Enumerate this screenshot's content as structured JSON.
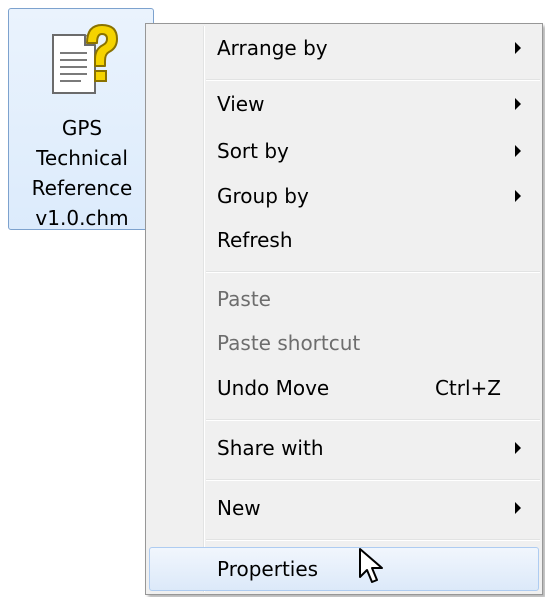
{
  "desktop": {
    "file": {
      "name_lines": [
        "GPS",
        "Technical",
        "Reference",
        "v1.0.chm"
      ],
      "icon": "chm-help-file-icon",
      "selected": true
    }
  },
  "context_menu": {
    "items": [
      {
        "label": "Arrange by",
        "has_submenu": true,
        "enabled": true
      },
      {
        "label": "View",
        "has_submenu": true,
        "enabled": true
      },
      {
        "label": "Sort by",
        "has_submenu": true,
        "enabled": true
      },
      {
        "label": "Group by",
        "has_submenu": true,
        "enabled": true
      },
      {
        "label": "Refresh",
        "has_submenu": false,
        "enabled": true
      },
      {
        "label": "Paste",
        "has_submenu": false,
        "enabled": false
      },
      {
        "label": "Paste shortcut",
        "has_submenu": false,
        "enabled": false
      },
      {
        "label": "Undo Move",
        "shortcut": "Ctrl+Z",
        "has_submenu": false,
        "enabled": true
      },
      {
        "label": "Share with",
        "has_submenu": true,
        "enabled": true
      },
      {
        "label": "New",
        "has_submenu": true,
        "enabled": true
      },
      {
        "label": "Properties",
        "has_submenu": false,
        "enabled": true,
        "highlighted": true
      }
    ]
  },
  "cursor": {
    "icon": "arrow-cursor-icon"
  },
  "colors": {
    "selection_border": "#7da2ce",
    "menu_background": "#f0f0f0",
    "disabled_text": "#6d6d6d",
    "highlight_border": "#aeccf1",
    "help_icon_yellow": "#f5d300"
  }
}
